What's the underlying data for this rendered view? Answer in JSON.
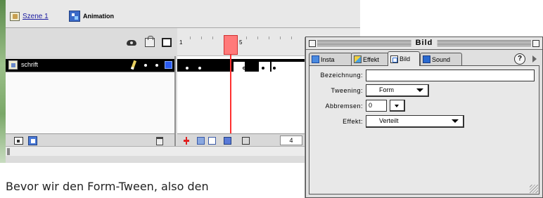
{
  "flash_window": {
    "scene_tab": {
      "label": "Szene 1",
      "icon": "scene-icon"
    },
    "symbol_tab": {
      "label": "Animation",
      "icon": "symbol-icon"
    },
    "layer_header_icons": [
      "eye-icon",
      "lock-icon",
      "outline-icon"
    ],
    "layer": {
      "name": "schrift",
      "outline_color": "#2a5af0"
    },
    "ruler": {
      "labels": [
        "1",
        "5"
      ]
    },
    "footer": {
      "current_frame": "4"
    },
    "playhead_color": "#ff3030"
  },
  "panel": {
    "title": "Bild",
    "tabs": [
      {
        "label": "Insta",
        "icon": "instance-icon"
      },
      {
        "label": "Effekt",
        "icon": "effect-icon"
      },
      {
        "label": "Bild",
        "icon": "frame-icon"
      },
      {
        "label": "Sound",
        "icon": "sound-icon"
      }
    ],
    "help_label": "?",
    "labels": {
      "name": "Bezeichnung:",
      "tweening": "Tweening:",
      "ease": "Abbremsen:",
      "effect": "Effekt:"
    },
    "values": {
      "name": "",
      "tweening": "Form",
      "ease": "0",
      "effect": "Verteilt"
    }
  },
  "body_text": {
    "line1": "Bevor wir den Form-Tween, also den",
    "line2": ""
  }
}
